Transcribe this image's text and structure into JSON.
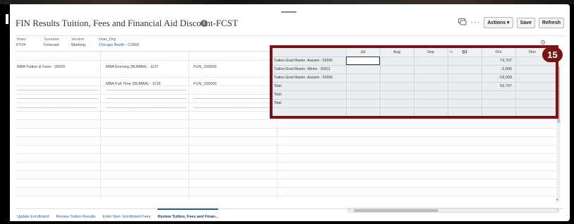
{
  "page": {
    "title": "FIN Results Tuition, Fees and Financial Aid Discount-FCST",
    "info_glyph": "i"
  },
  "toolbar": {
    "more_label": "···",
    "actions_label": "Actions ▾",
    "save_label": "Save",
    "refresh_label": "Refresh"
  },
  "pov": [
    {
      "label": "Years",
      "value": "FY24"
    },
    {
      "label": "Scenario",
      "value": "Forecast"
    },
    {
      "label": "Version",
      "value": "Working"
    },
    {
      "label": "User_Org",
      "value": "Chicago Booth - C2800"
    }
  ],
  "grid": {
    "row_items": [
      {
        "program": "MBA Tuition & Fees - 28320",
        "class": "MBA Evening (BUMBA) - 1127",
        "fund": "FUN_100000"
      },
      {
        "program": "",
        "class": "MBA Full-Time (BUMBA) - 1129",
        "fund": "FUN_100000"
      }
    ],
    "dashes": "------------------------------------------------------------------------------------------------------"
  },
  "detail": {
    "columns": [
      "Jul",
      "Aug",
      "Sep",
      "Q1",
      "Oct",
      "Nov"
    ],
    "rows": [
      {
        "label": "Tuition-Grad Master -Autumn - 50206",
        "oct": "73,707"
      },
      {
        "label": "Tuition-Grad Master -Winter - 50211",
        "oct": "-2,000"
      },
      {
        "label": "Tuition-Grad Master -Autumn - 50206",
        "oct": "-18,000"
      },
      {
        "label": "Total",
        "oct": "53,707"
      },
      {
        "label": "Total",
        "oct": ""
      },
      {
        "label": "Total",
        "oct": ""
      }
    ]
  },
  "callout": {
    "number": "15"
  },
  "tabs": [
    {
      "label": "Update Enrollment"
    },
    {
      "label": "Review Tuition Results"
    },
    {
      "label": "Enter Non- Enrollment Fees"
    },
    {
      "label": "Review Tuition, Fees and Finan..."
    }
  ],
  "colors": {
    "accent": "#1f5f9e",
    "callout": "#7a1515"
  }
}
